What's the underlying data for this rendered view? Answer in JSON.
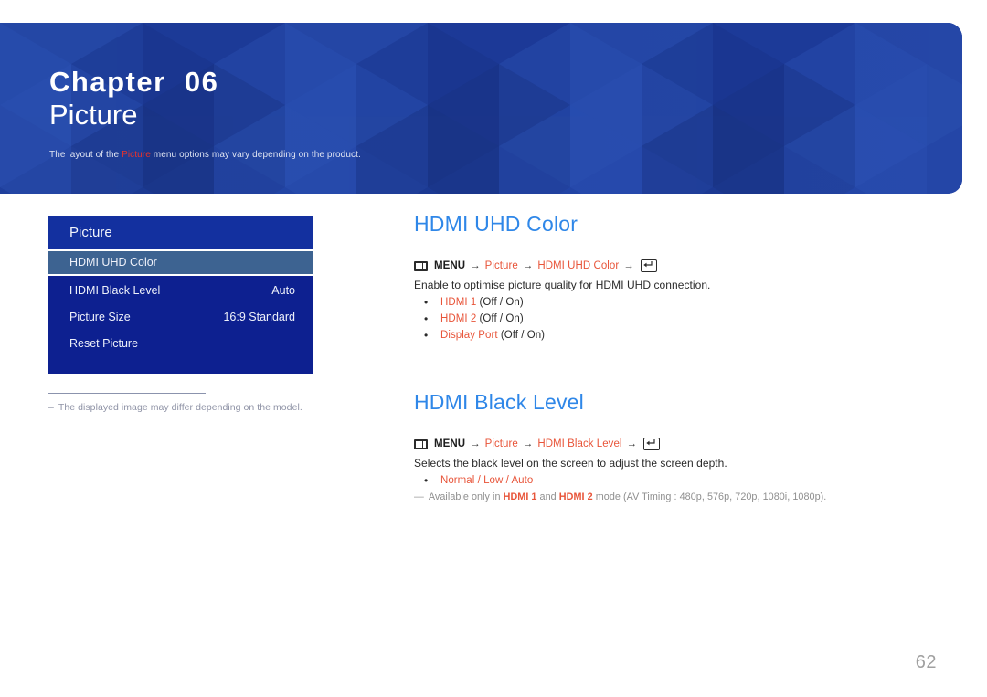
{
  "banner": {
    "chapter": "Chapter  06",
    "title": "Picture",
    "note_prefix": "The layout of the ",
    "note_highlight": "Picture",
    "note_suffix": " menu options may vary depending on the product.",
    "bg_color": "#1e3f9e",
    "highlight_color": "#e8322a"
  },
  "osd": {
    "header": "Picture",
    "rows": [
      {
        "label": "HDMI UHD Color",
        "value": "",
        "selected": true
      },
      {
        "label": "HDMI Black Level",
        "value": "Auto",
        "selected": false
      },
      {
        "label": "Picture Size",
        "value": "16:9 Standard",
        "selected": false
      },
      {
        "label": "Reset Picture",
        "value": "",
        "selected": false
      }
    ],
    "bg_color": "#0d2090",
    "selected_color": "#3d6391"
  },
  "left_note": {
    "dash": "–",
    "text": "The displayed image may differ depending on the model."
  },
  "sections": [
    {
      "title": "HDMI UHD Color",
      "breadcrumb": {
        "menu_icon": "menu-icon",
        "menu_label": "MENU",
        "arrow": "→",
        "crumb1": "Picture",
        "crumb2": "HDMI UHD Color",
        "enter_icon": "enter-icon"
      },
      "description": "Enable to optimise picture quality for HDMI UHD connection.",
      "options": [
        {
          "name": "HDMI 1",
          "values": "(Off / On)"
        },
        {
          "name": "HDMI 2",
          "values": "(Off / On)"
        },
        {
          "name": "Display Port",
          "values": "(Off / On)"
        }
      ],
      "subnote": null
    },
    {
      "title": "HDMI Black Level",
      "breadcrumb": {
        "menu_icon": "menu-icon",
        "menu_label": "MENU",
        "arrow": "→",
        "crumb1": "Picture",
        "crumb2": "HDMI Black Level",
        "enter_icon": "enter-icon"
      },
      "description": "Selects the black level on the screen to adjust the screen depth.",
      "options": [
        {
          "name": "Normal / Low / Auto",
          "values": ""
        }
      ],
      "subnote": {
        "dash": "—",
        "part1": "Available only in ",
        "red1": "HDMI 1",
        "part2": " and ",
        "red2": "HDMI 2",
        "part3": " mode (AV Timing : 480p, 576p, 720p, 1080i, 1080p)."
      }
    }
  ],
  "page_number": "62"
}
